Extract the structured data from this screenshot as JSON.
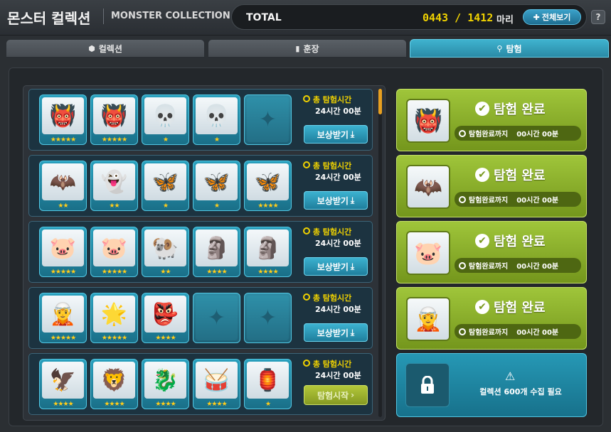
{
  "header": {
    "title_ko": "몬스터 컬렉션",
    "title_en": "MONSTER COLLECTION",
    "total_label": "TOTAL",
    "total_count": "0443 / 1412",
    "total_unit": "마리",
    "view_all_label": "전체보기",
    "help_label": "?"
  },
  "tabs": [
    {
      "label": "컬렉션",
      "icon": "cube-icon",
      "active": false
    },
    {
      "label": "훈장",
      "icon": "bookmark-icon",
      "active": false
    },
    {
      "label": "탐험",
      "icon": "map-pin-icon",
      "active": true
    }
  ],
  "expeditions": [
    {
      "timer_title": "총 탐험시간",
      "timer_value": "24시간 00분",
      "button_label": "보상받기",
      "button_type": "reward",
      "slots": [
        {
          "monster": "dark-winged-demon",
          "glyph": "👹",
          "stars": "★★★★★"
        },
        {
          "monster": "dark-winged-demon",
          "glyph": "👹",
          "stars": "★★★★★"
        },
        {
          "monster": "bone-dragon",
          "glyph": "💀",
          "stars": "★"
        },
        {
          "monster": "bone-dragon",
          "glyph": "💀",
          "stars": "★"
        },
        {
          "monster": "empty",
          "glyph": "",
          "stars": ""
        }
      ]
    },
    {
      "timer_title": "총 탐험시간",
      "timer_value": "24시간 00분",
      "button_label": "보상받기",
      "button_type": "reward",
      "slots": [
        {
          "monster": "green-bat",
          "glyph": "🦇",
          "stars": "★★"
        },
        {
          "monster": "ghost-spirit",
          "glyph": "👻",
          "stars": "★★"
        },
        {
          "monster": "purple-butterfly",
          "glyph": "🦋",
          "stars": "★"
        },
        {
          "monster": "green-butterfly",
          "glyph": "🦋",
          "stars": "★"
        },
        {
          "monster": "red-butterfly",
          "glyph": "🦋",
          "stars": "★★★★"
        }
      ]
    },
    {
      "timer_title": "총 탐험시간",
      "timer_value": "24시간 00분",
      "button_label": "보상받기",
      "button_type": "reward",
      "slots": [
        {
          "monster": "pink-bean",
          "glyph": "🐷",
          "stars": "★★★★★"
        },
        {
          "monster": "pink-bean",
          "glyph": "🐷",
          "stars": "★★★★★"
        },
        {
          "monster": "white-beast",
          "glyph": "🐏",
          "stars": "★★"
        },
        {
          "monster": "stone-totem",
          "glyph": "🗿",
          "stars": "★★★★"
        },
        {
          "monster": "stone-gargoyle",
          "glyph": "🗿",
          "stars": "★★★★"
        }
      ]
    },
    {
      "timer_title": "총 탐험시간",
      "timer_value": "24시간 00분",
      "button_label": "보상받기",
      "button_type": "reward",
      "slots": [
        {
          "monster": "dark-sorceress",
          "glyph": "🧝",
          "stars": "★★★★★"
        },
        {
          "monster": "white-spirit",
          "glyph": "🌟",
          "stars": "★★★★★"
        },
        {
          "monster": "horned-golem",
          "glyph": "👺",
          "stars": "★★★★"
        },
        {
          "monster": "empty",
          "glyph": "",
          "stars": ""
        },
        {
          "monster": "empty",
          "glyph": "",
          "stars": ""
        }
      ]
    },
    {
      "timer_title": "총 탐험시간",
      "timer_value": "24시간 00분",
      "button_label": "탐험시작",
      "button_type": "start",
      "slots": [
        {
          "monster": "shadow-wing",
          "glyph": "🦅",
          "stars": "★★★★"
        },
        {
          "monster": "golden-warrior",
          "glyph": "🦁",
          "stars": "★★★★"
        },
        {
          "monster": "red-dragon-knight",
          "glyph": "🐉",
          "stars": "★★★★"
        },
        {
          "monster": "round-mask",
          "glyph": "🥁",
          "stars": "★★★★"
        },
        {
          "monster": "lantern-spirit",
          "glyph": "🏮",
          "stars": "★"
        }
      ]
    }
  ],
  "results": [
    {
      "title": "탐험 완료",
      "time_label": "탐험완료까지",
      "time_value": "00시간 00분",
      "monster": "dark-winged-demon",
      "glyph": "👹"
    },
    {
      "title": "탐험 완료",
      "time_label": "탐험완료까지",
      "time_value": "00시간 00분",
      "monster": "green-bat",
      "glyph": "🦇"
    },
    {
      "title": "탐험 완료",
      "time_label": "탐험완료까지",
      "time_value": "00시간 00분",
      "monster": "pink-bean",
      "glyph": "🐷"
    },
    {
      "title": "탐험 완료",
      "time_label": "탐험완료까지",
      "time_value": "00시간 00분",
      "monster": "dark-sorceress",
      "glyph": "🧝"
    }
  ],
  "locked_slot": {
    "message": "컬렉션 600개 수집 필요",
    "icon": "lock-icon"
  },
  "colors": {
    "accent_teal": "#2a9cba",
    "complete_green": "#8ab42c",
    "count_yellow": "#f0d200",
    "star_yellow": "#ffcc1a"
  }
}
